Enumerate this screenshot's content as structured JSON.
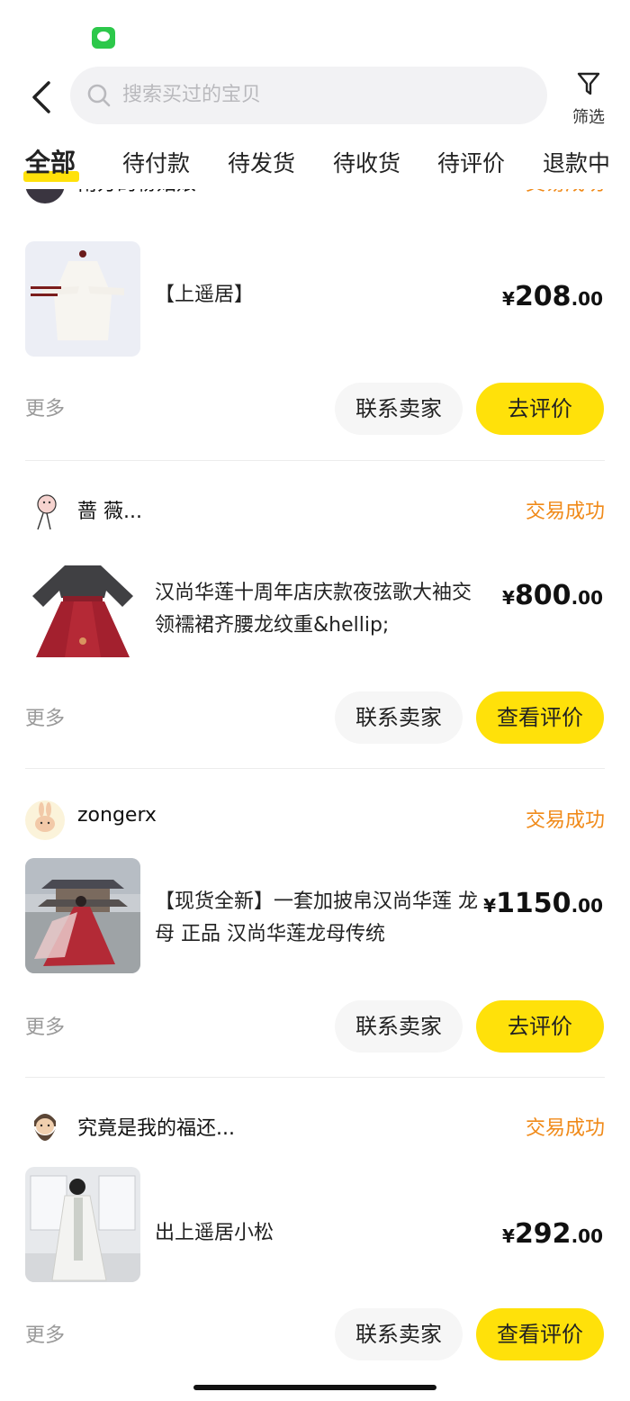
{
  "status_bar": {
    "notification_icon": "message-icon"
  },
  "header": {
    "back_icon": "back-chevron-icon",
    "search_placeholder": "搜索买过的宝贝",
    "filter_label": "筛选"
  },
  "tabs": [
    {
      "label": "全部",
      "active": true
    },
    {
      "label": "待付款"
    },
    {
      "label": "待发货"
    },
    {
      "label": "待收货"
    },
    {
      "label": "待评价"
    },
    {
      "label": "退款中"
    }
  ],
  "orders": [
    {
      "seller": "南方的粉姑娘",
      "status": "交易成功",
      "title": "【上遥居】",
      "price_int": "208",
      "price_dec": ".00",
      "currency": "¥",
      "more": "更多",
      "contact": "联系卖家",
      "action": "去评价"
    },
    {
      "seller": "蔷 薇...",
      "status": "交易成功",
      "title": "汉尚华莲十周年店庆款夜弦歌大袖交领襦裙齐腰龙纹重&hellip;",
      "price_int": "800",
      "price_dec": ".00",
      "currency": "¥",
      "more": "更多",
      "contact": "联系卖家",
      "action": "查看评价"
    },
    {
      "seller": "zongerx",
      "status": "交易成功",
      "title": "【现货全新】一套加披帛汉尚华莲 龙母 正品 汉尚华莲龙母传统",
      "price_int": "1150",
      "price_dec": ".00",
      "currency": "¥",
      "more": "更多",
      "contact": "联系卖家",
      "action": "去评价"
    },
    {
      "seller": "究竟是我的福还...",
      "status": "交易成功",
      "title": "出上遥居小松",
      "price_int": "292",
      "price_dec": ".00",
      "currency": "¥",
      "more": "更多",
      "contact": "联系卖家",
      "action": "查看评价"
    }
  ],
  "colors": {
    "accent": "#ffe10a",
    "status": "#f08a19",
    "search_bg": "#f2f2f4"
  }
}
